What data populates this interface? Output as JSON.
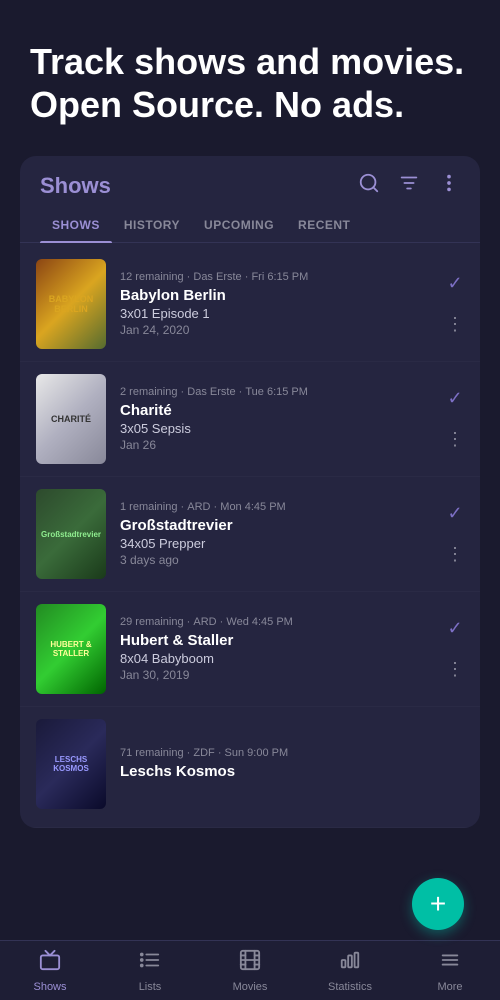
{
  "hero": {
    "title": "Track shows and movies. Open Source. No ads."
  },
  "card": {
    "title": "Shows",
    "tabs": [
      {
        "label": "SHOWS",
        "active": true
      },
      {
        "label": "HISTORY",
        "active": false
      },
      {
        "label": "UPCOMING",
        "active": false
      },
      {
        "label": "RECENT",
        "active": false
      }
    ]
  },
  "shows": [
    {
      "poster_text": "BABYLON BERLIN",
      "poster_class": "poster-babylon",
      "remaining": "12 remaining",
      "channel": "Das Erste",
      "day_time": "Fri 6:15 PM",
      "name": "Babylon Berlin",
      "episode": "3x01 Episode 1",
      "date": "Jan 24, 2020"
    },
    {
      "poster_text": "CHARITÉ",
      "poster_class": "poster-charite",
      "remaining": "2 remaining",
      "channel": "Das Erste",
      "day_time": "Tue 6:15 PM",
      "name": "Charité",
      "episode": "3x05 Sepsis",
      "date": "Jan 26"
    },
    {
      "poster_text": "Großstadt­revier",
      "poster_class": "poster-grossstadt",
      "remaining": "1 remaining",
      "channel": "ARD",
      "day_time": "Mon 4:45 PM",
      "name": "Großstadtrevier",
      "episode": "34x05 Prepper",
      "date": "3 days ago"
    },
    {
      "poster_text": "HUBERT & STALLER",
      "poster_class": "poster-hubert",
      "remaining": "29 remaining",
      "channel": "ARD",
      "day_time": "Wed 4:45 PM",
      "name": "Hubert & Staller",
      "episode": "8x04 Babyboom",
      "date": "Jan 30, 2019"
    },
    {
      "poster_text": "LESCHS KOSMOS",
      "poster_class": "poster-leschs",
      "remaining": "71 remaining",
      "channel": "ZDF",
      "day_time": "Sun 9:00 PM",
      "name": "Leschs Kosmos",
      "episode": "",
      "date": ""
    }
  ],
  "fab": {
    "label": "+"
  },
  "bottom_nav": [
    {
      "icon": "tv",
      "label": "Shows",
      "active": true
    },
    {
      "icon": "list",
      "label": "Lists",
      "active": false
    },
    {
      "icon": "movie",
      "label": "Movies",
      "active": false
    },
    {
      "icon": "statistics",
      "label": "Statistics",
      "active": false
    },
    {
      "icon": "more",
      "label": "More",
      "active": false
    }
  ]
}
